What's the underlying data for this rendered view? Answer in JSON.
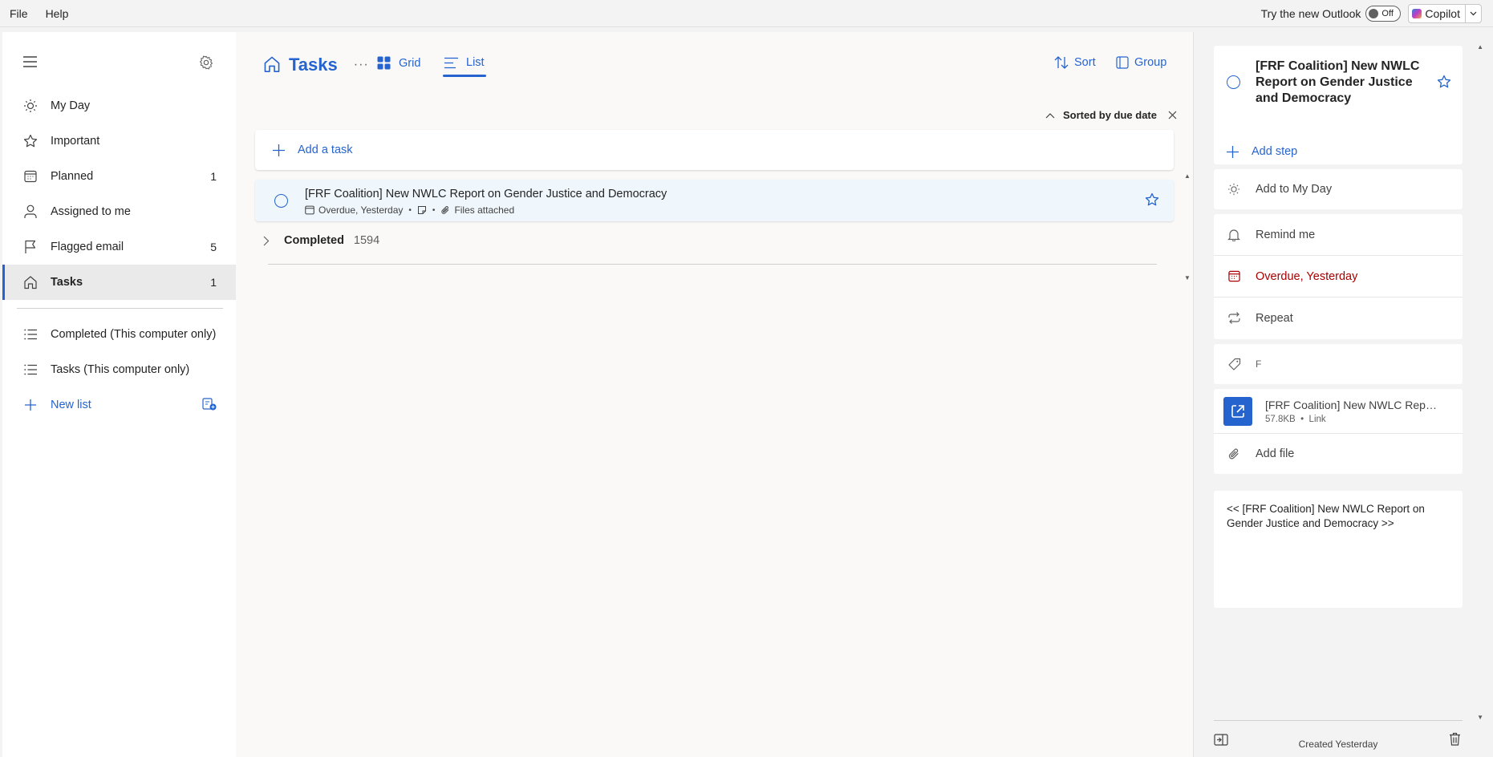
{
  "menubar": {
    "file": "File",
    "help": "Help",
    "try_new_outlook": "Try the new Outlook",
    "toggle_state": "Off",
    "copilot": "Copilot"
  },
  "sidebar": {
    "items": [
      {
        "label": "My Day",
        "count": "",
        "icon": "sun-icon"
      },
      {
        "label": "Important",
        "count": "",
        "icon": "star-icon"
      },
      {
        "label": "Planned",
        "count": "1",
        "icon": "calendar-icon"
      },
      {
        "label": "Assigned to me",
        "count": "",
        "icon": "person-icon"
      },
      {
        "label": "Flagged email",
        "count": "5",
        "icon": "flag-icon"
      },
      {
        "label": "Tasks",
        "count": "1",
        "icon": "home-icon"
      }
    ],
    "lists": [
      {
        "label": "Completed (This computer only)",
        "icon": "list-icon"
      },
      {
        "label": "Tasks (This computer only)",
        "icon": "list-icon"
      }
    ],
    "new_list": "New list"
  },
  "main": {
    "title": "Tasks",
    "tabs": [
      {
        "label": "Grid"
      },
      {
        "label": "List"
      }
    ],
    "sort": "Sort",
    "group": "Group",
    "sorted_by": "Sorted by due date",
    "add_task": "Add a task",
    "task": {
      "title": "[FRF Coalition] New NWLC Report on Gender Justice and Democracy",
      "due": "Overdue, Yesterday",
      "files": "Files attached"
    },
    "completed_label": "Completed",
    "completed_count": "1594"
  },
  "details": {
    "title": "[FRF Coalition] New NWLC Report on Gender Justice and Democracy",
    "add_step": "Add step",
    "add_to_my_day": "Add to My Day",
    "remind_me": "Remind me",
    "due": "Overdue, Yesterday",
    "repeat": "Repeat",
    "category_placeholder": "F",
    "file_name": "[FRF Coalition] New NWLC Report on Gender Justice and Democracy",
    "file_size": "57.8KB",
    "file_type": "Link",
    "add_file": "Add file",
    "note": "<< [FRF Coalition] New NWLC Report on Gender Justice and Democracy >>",
    "created": "Created Yesterday"
  },
  "colors": {
    "accent": "#2564cf",
    "overdue": "#a80000"
  }
}
